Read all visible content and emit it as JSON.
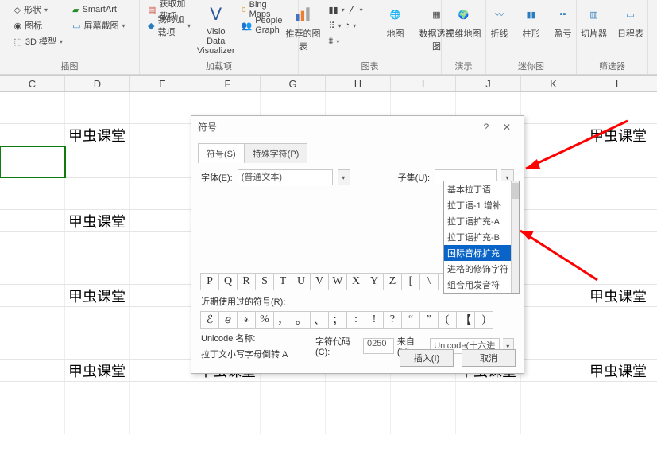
{
  "ribbon": {
    "group1": {
      "caption": "插图",
      "shape": "形状",
      "icon_btn": "图标",
      "model3d": "3D 模型",
      "smartart": "SmartArt",
      "screenshot": "屏幕截图"
    },
    "group2": {
      "caption": "加载项",
      "get_addins": "获取加载项",
      "my_addins": "我的加载项",
      "visio": "Visio Data Visualizer",
      "bing": "Bing Maps",
      "people": "People Graph"
    },
    "group3": {
      "caption": "图表",
      "rec": "推荐的图表",
      "map": "地图",
      "pivot": "数据透视图"
    },
    "group4": {
      "caption": "演示",
      "sparkmap": "三维地图"
    },
    "group5": {
      "caption": "迷你图",
      "line": "折线",
      "col": "柱形",
      "winloss": "盈亏"
    },
    "group6": {
      "caption": "筛选器",
      "slicer": "切片器",
      "timeline": "日程表"
    }
  },
  "columns": [
    "C",
    "D",
    "E",
    "F",
    "G",
    "H",
    "I",
    "J",
    "K",
    "L"
  ],
  "cellText": "甲虫课堂",
  "dialog": {
    "title": "符号",
    "help": "?",
    "tabs": {
      "symbols": "符号(S)",
      "special": "特殊字符(P)"
    },
    "font_label": "字体(E):",
    "font_value": "(普通文本)",
    "subset_label": "子集(U):",
    "subset_options": [
      "基本拉丁语",
      "拉丁语-1 增补",
      "拉丁语扩充-A",
      "拉丁语扩充-B",
      "国际音标扩充",
      "进格的修饰字符",
      "组合用发音符"
    ],
    "char_grid": [
      "P",
      "Q",
      "R",
      "S",
      "T",
      "U",
      "V",
      "W",
      "X",
      "Y",
      "Z",
      "[",
      "\\",
      "]"
    ],
    "recent_label": "近期使用过的符号(R):",
    "recent_chars": [
      "ℰ",
      "ℯ",
      "𝓇",
      "%",
      "，",
      "。",
      "、",
      "；",
      ":",
      "!",
      "?",
      "“",
      "”",
      "(",
      "【",
      ")"
    ],
    "unicode_name_label": "Unicode 名称:",
    "unicode_name": "拉丁文小写字母倒转 A",
    "code_label": "字符代码(C):",
    "code_value": "0250",
    "from_label": "来自(M):",
    "from_value": "Unicode(十六进制)",
    "insert": "插入(I)",
    "cancel": "取消"
  }
}
